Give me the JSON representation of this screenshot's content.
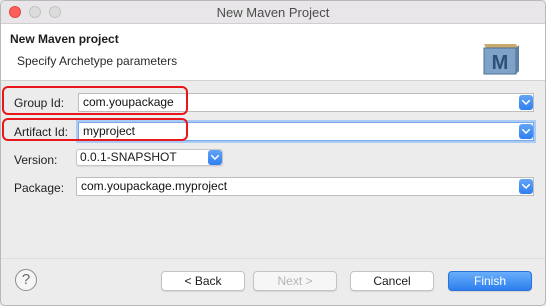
{
  "window": {
    "title": "New Maven Project"
  },
  "header": {
    "title": "New Maven project",
    "subtitle": "Specify Archetype parameters",
    "logo_letter": "M"
  },
  "form": {
    "group_id": {
      "label": "Group Id:",
      "value": "com.youpackage"
    },
    "artifact_id": {
      "label": "Artifact Id:",
      "value": "myproject"
    },
    "version": {
      "label": "Version:",
      "value": "0.0.1-SNAPSHOT"
    },
    "package": {
      "label": "Package:",
      "value": "com.youpackage.myproject"
    }
  },
  "buttons": {
    "help": "?",
    "back": "< Back",
    "next": "Next >",
    "cancel": "Cancel",
    "finish": "Finish"
  },
  "colors": {
    "accent": "#2f7ff0",
    "annotation": "#e8171b"
  },
  "icons": {
    "dropdown": "chevron-down-icon",
    "help": "help-icon",
    "logo": "maven-logo-icon"
  }
}
